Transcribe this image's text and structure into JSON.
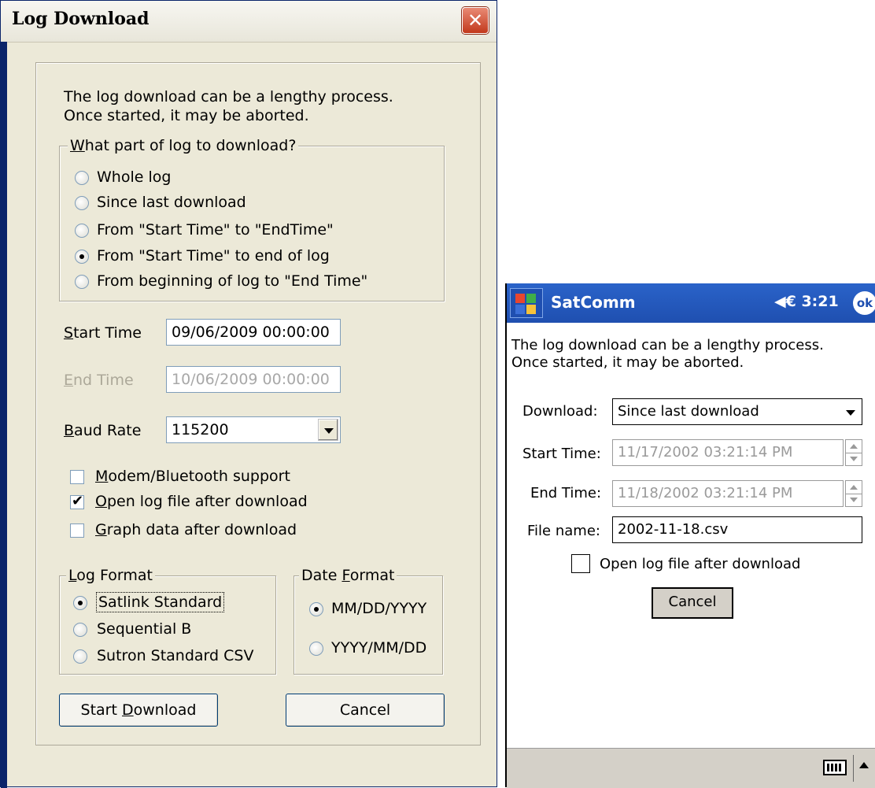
{
  "dialog": {
    "title": "Log Download",
    "intro_line1": "The log download can be a lengthy process.",
    "intro_line2": "Once started, it may be aborted.",
    "part_group": {
      "legend_accel": "W",
      "legend_rest": "hat part of log to download?",
      "options": [
        {
          "label": "Whole log",
          "selected": false
        },
        {
          "label": "Since last download",
          "selected": false
        },
        {
          "label": "From \"Start Time\" to \"EndTime\"",
          "selected": false
        },
        {
          "label": "From \"Start Time\" to end of log",
          "selected": true
        },
        {
          "label": "From beginning of log to \"End Time\"",
          "selected": false
        }
      ]
    },
    "start_time": {
      "label_accel": "S",
      "label_rest": "tart Time",
      "value": "09/06/2009 00:00:00"
    },
    "end_time": {
      "label_accel": "E",
      "label_rest": "nd Time",
      "value": "10/06/2009 00:00:00"
    },
    "baud_rate": {
      "label_accel": "B",
      "label_rest": "aud Rate",
      "value": "115200"
    },
    "checkboxes": [
      {
        "accel": "M",
        "rest": "odem/Bluetooth support",
        "checked": false
      },
      {
        "accel": "O",
        "rest": "pen log file after download",
        "checked": true
      },
      {
        "accel": "G",
        "rest": "raph data after download",
        "checked": false
      }
    ],
    "log_format": {
      "legend_accel": "L",
      "legend_rest": "og Format",
      "options": [
        {
          "label": "Satlink Standard",
          "selected": true
        },
        {
          "label": "Sequential B",
          "selected": false
        },
        {
          "label": "Sutron Standard CSV",
          "selected": false
        }
      ]
    },
    "date_format": {
      "legend_pre": "Date ",
      "legend_accel": "F",
      "legend_rest": "ormat",
      "options": [
        {
          "label": "MM/DD/YYYY",
          "selected": true
        },
        {
          "label": "YYYY/MM/DD",
          "selected": false
        }
      ]
    },
    "start_button": {
      "pre": "Start ",
      "accel": "D",
      "rest": "ownload"
    },
    "cancel_button": "Cancel"
  },
  "pocketpc": {
    "app_title": "SatComm",
    "clock": "◀€ 3:21",
    "ok_label": "ok",
    "intro_line1": "The log download can be a lengthy process.",
    "intro_line2": "Once started, it may be aborted.",
    "download_label": "Download:",
    "download_value": "Since last download",
    "start_label": "Start Time:",
    "start_value": "11/17/2002 03:21:14 PM",
    "end_label": "End Time:",
    "end_value": "11/18/2002 03:21:14 PM",
    "file_label": "File name:",
    "file_value": "2002-11-18.csv",
    "open_log_label": "Open log file after download",
    "open_log_checked": false,
    "cancel_label": "Cancel"
  }
}
